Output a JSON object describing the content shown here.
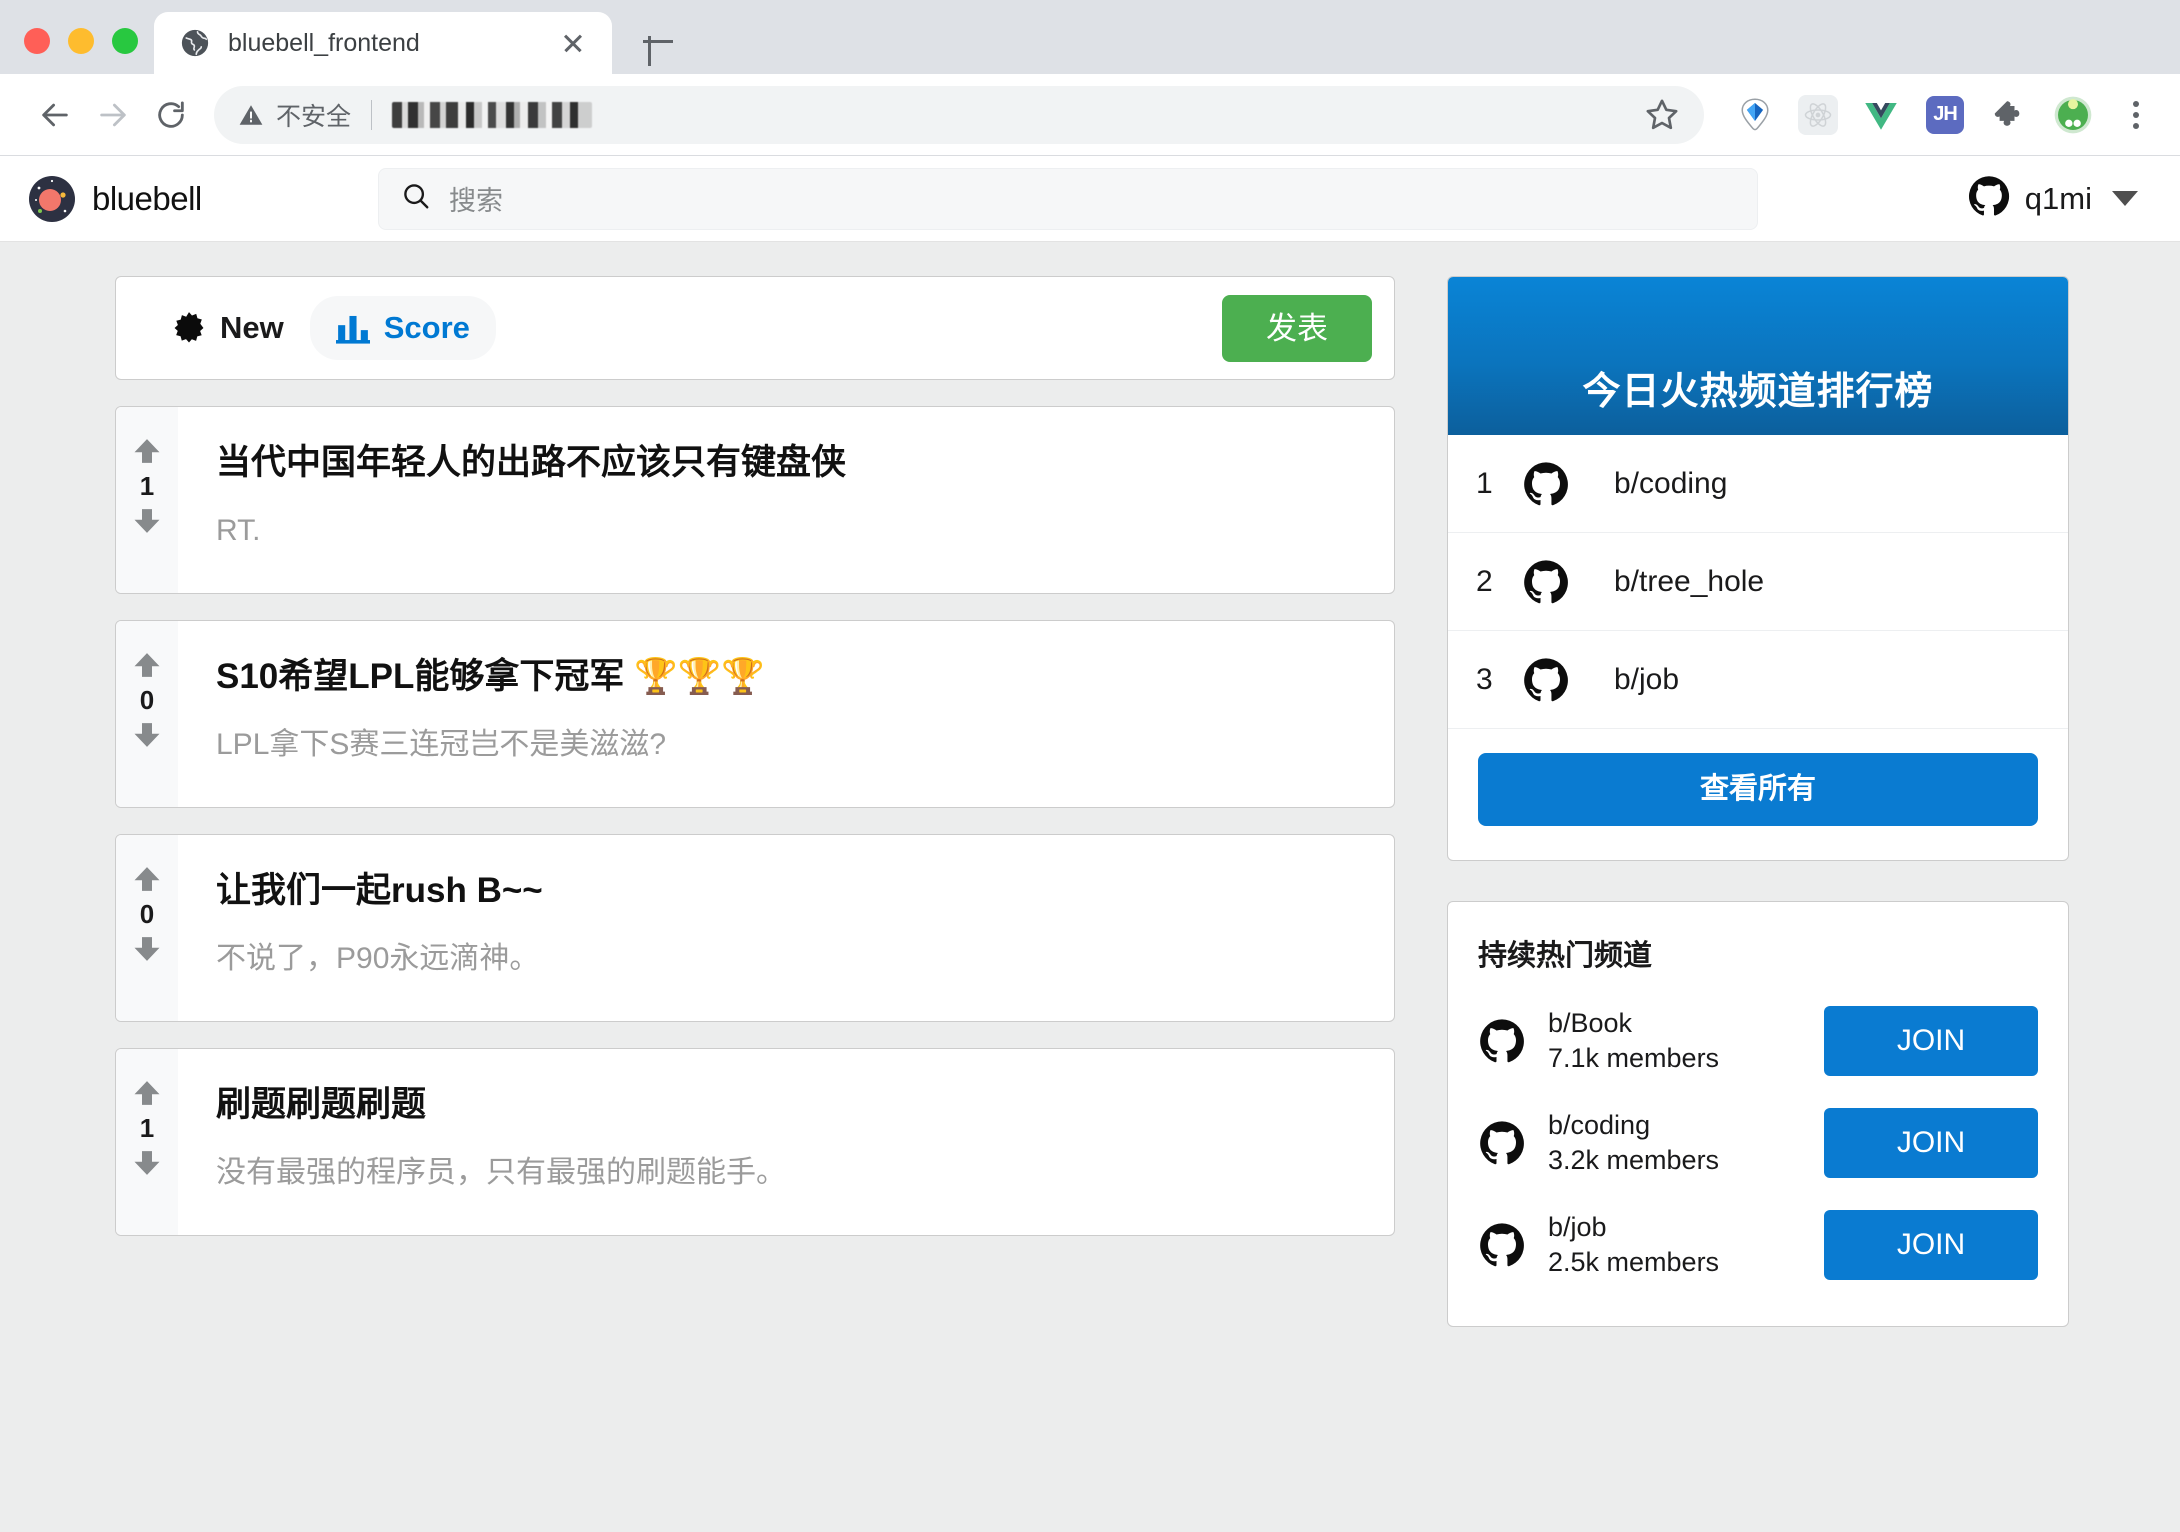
{
  "browser": {
    "tab": {
      "title": "bluebell_frontend",
      "favicon_icon": "globe-icon",
      "close_icon": "close-icon"
    },
    "newtab_icon": "plus-icon",
    "nav": {
      "back_icon": "arrow-back-icon",
      "forward_icon": "arrow-forward-icon",
      "reload_icon": "reload-icon"
    },
    "omnibox": {
      "security_icon": "warning-triangle-icon",
      "security_label": "不安全",
      "url_text": "",
      "bookmark_icon": "star-icon"
    },
    "extensions": [
      {
        "name": "vuex-devtools-icon",
        "label": ""
      },
      {
        "name": "react-devtools-icon",
        "label": ""
      },
      {
        "name": "vue-devtools-icon",
        "label": ""
      },
      {
        "name": "jh-extension-icon",
        "label": "JH"
      },
      {
        "name": "puzzle-extensions-icon",
        "label": ""
      },
      {
        "name": "profile-avatar-icon",
        "label": ""
      }
    ],
    "menu_icon": "kebab-menu-icon"
  },
  "appbar": {
    "logo_icon": "bluebell-planet-logo",
    "brand": "bluebell",
    "search": {
      "icon": "search-icon",
      "placeholder": "搜索",
      "value": ""
    },
    "user": {
      "avatar_icon": "github-icon",
      "name": "q1mi",
      "caret_icon": "chevron-down-icon"
    }
  },
  "sortbar": {
    "tabs": [
      {
        "label": "New",
        "icon": "burst-icon",
        "active": false
      },
      {
        "label": "Score",
        "icon": "bar-chart-icon",
        "active": true
      }
    ],
    "publish_label": "发表"
  },
  "posts": [
    {
      "title": "当代中国年轻人的出路不应该只有键盘侠",
      "description": "RT.",
      "votes": "1",
      "upvote_icon": "arrow-up-icon",
      "downvote_icon": "arrow-down-icon"
    },
    {
      "title": "S10希望LPL能够拿下冠军 🏆🏆🏆",
      "description": "LPL拿下S赛三连冠岂不是美滋滋?",
      "votes": "0",
      "upvote_icon": "arrow-up-icon",
      "downvote_icon": "arrow-down-icon"
    },
    {
      "title": "让我们一起rush B~~",
      "description": "不说了，P90永远滴神。",
      "votes": "0",
      "upvote_icon": "arrow-up-icon",
      "downvote_icon": "arrow-down-icon"
    },
    {
      "title": "刷题刷题刷题",
      "description": "没有最强的程序员，只有最强的刷题能手。",
      "votes": "1",
      "upvote_icon": "arrow-up-icon",
      "downvote_icon": "arrow-down-icon"
    }
  ],
  "sidebar": {
    "ranking": {
      "title": "今日火热频道排行榜",
      "rows": [
        {
          "rank": "1",
          "icon": "github-icon",
          "name": "b/coding"
        },
        {
          "rank": "2",
          "icon": "github-icon",
          "name": "b/tree_hole"
        },
        {
          "rank": "3",
          "icon": "github-icon",
          "name": "b/job"
        }
      ],
      "view_all_label": "查看所有"
    },
    "hot": {
      "title": "持续热门频道",
      "rows": [
        {
          "icon": "github-icon",
          "name": "b/Book",
          "members": "7.1k members",
          "join_label": "JOIN"
        },
        {
          "icon": "github-icon",
          "name": "b/coding",
          "members": "3.2k members",
          "join_label": "JOIN"
        },
        {
          "icon": "github-icon",
          "name": "b/job",
          "members": "2.5k members",
          "join_label": "JOIN"
        }
      ]
    }
  },
  "colors": {
    "accent_blue": "#0a7bd1",
    "rank_header_blue": "#0b74bd",
    "publish_green": "#4caf50",
    "page_bg": "#eceded",
    "muted_text": "#9b9b9b"
  }
}
